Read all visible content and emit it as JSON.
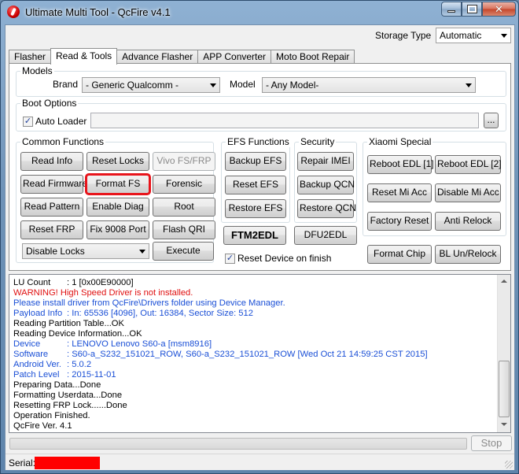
{
  "window": {
    "title": "Ultimate Multi Tool - QcFire v4.1"
  },
  "storage": {
    "label": "Storage Type",
    "value": "Automatic"
  },
  "tabs": [
    {
      "label": "Flasher"
    },
    {
      "label": "Read & Tools"
    },
    {
      "label": "Advance Flasher"
    },
    {
      "label": "APP Converter"
    },
    {
      "label": "Moto Boot Repair"
    }
  ],
  "models": {
    "title": "Models",
    "brand_label": "Brand",
    "brand_value": "- Generic Qualcomm -",
    "model_label": "Model",
    "model_value": "- Any Model-"
  },
  "boot": {
    "title": "Boot Options",
    "auto_loader_label": "Auto Loader",
    "browse_label": "..."
  },
  "common": {
    "title": "Common Functions",
    "read_info": "Read Info",
    "reset_locks": "Reset Locks",
    "vivo_frp": "Vivo FS/FRP",
    "read_firmware": "Read Firmware",
    "format_fs": "Format FS",
    "forensic": "Forensic",
    "read_pattern": "Read Pattern",
    "enable_diag": "Enable Diag",
    "root": "Root",
    "reset_frp": "Reset FRP",
    "fix_9008": "Fix 9008 Port",
    "flash_qri": "Flash QRI",
    "locks_select": "Disable Locks",
    "execute": "Execute"
  },
  "efs": {
    "title": "EFS Functions",
    "backup": "Backup EFS",
    "reset": "Reset EFS",
    "restore": "Restore EFS"
  },
  "security": {
    "title": "Security",
    "repair_imei": "Repair IMEI",
    "backup_qcn": "Backup QCN",
    "restore_qcn": "Restore QCN"
  },
  "ftm2edl": "FTM2EDL",
  "dfu2edl": "DFU2EDL",
  "reset_device_label": "Reset Device on finish",
  "xiaomi": {
    "title": "Xiaomi Special",
    "reboot_edl_1": "Reboot EDL [1]",
    "reboot_edl_2": "Reboot EDL [2]",
    "reset_mi_acc": "Reset Mi Acc",
    "disable_mi_acc": "Disable Mi Acc",
    "factory_reset": "Factory Reset",
    "anti_relock": "Anti Relock"
  },
  "format_chip": "Format Chip",
  "bl_relock": "BL Un/Relock",
  "log": {
    "lu_count_k": "LU Count",
    "lu_count_v": ": 1 [0x00E90000]",
    "warning": "WARNING! High Speed Driver is not installed.",
    "install_hint": "Please install driver from QcFire\\Drivers folder using Device Manager.",
    "payload_k": "Payload Info",
    "payload_v": ": In: 65536 [4096], Out: 16384, Sector Size: 512",
    "reading_partition": "Reading Partition Table...OK",
    "reading_device": "Reading Device Information...OK",
    "device_k": "Device",
    "device_v": ": LENOVO Lenovo S60-a [msm8916]",
    "software_k": "Software",
    "software_v": ": S60-a_S232_151021_ROW, S60-a_S232_151021_ROW [Wed Oct 21 14:59:25 CST 2015]",
    "android_k": "Android Ver.",
    "android_v": ": 5.0.2",
    "patch_k": "Patch Level",
    "patch_v": ": 2015-11-01",
    "preparing": "Preparing Data...Done",
    "formatting": "Formatting Userdata...Done",
    "resetting_frp": "Resetting FRP Lock......Done",
    "finished": "Operation Finished.",
    "version": "QcFire Ver. 4.1"
  },
  "stop": "Stop",
  "serial_label": "Serial:",
  "colors": {
    "log_blue": "#1a4fd6",
    "warning_red": "#e01010",
    "serial_red": "#ff0000",
    "highlight": "#e8141b"
  }
}
